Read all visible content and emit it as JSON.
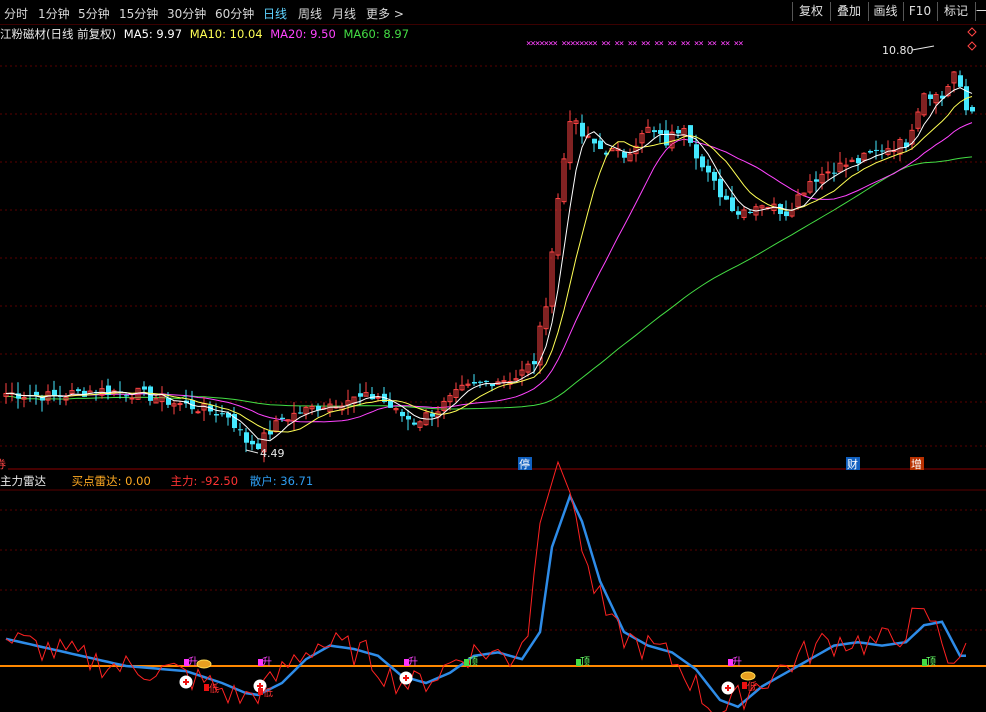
{
  "toolbar": {
    "timeframes": [
      "分时",
      "1分钟",
      "5分钟",
      "15分钟",
      "30分钟",
      "60分钟",
      "日线",
      "周线",
      "月线",
      "更多 >"
    ],
    "active_timeframe": "日线",
    "buttons": [
      "复权",
      "叠加",
      "画线",
      "F10",
      "标记",
      "一"
    ]
  },
  "legend": {
    "title": "江粉磁材(日线 前复权)",
    "ma5": "MA5: 9.97",
    "ma10": "MA10: 10.04",
    "ma20": "MA20: 9.50",
    "ma60": "MA60: 8.97"
  },
  "annotations": {
    "high_label": "10.80",
    "low_label": "4.49",
    "left_marker": "券",
    "stop_marker": "停",
    "fin_marker": "财",
    "inc_marker": "增"
  },
  "indicator": {
    "title": "主力雷达",
    "buy": "买点雷达: 0.00",
    "main": "主力: -92.50",
    "retail": "散户: 36.71",
    "rise_label": "升",
    "top_label": "顶",
    "low_label": "低"
  },
  "colors": {
    "ma5": "#ffffff",
    "ma10": "#ffff55",
    "ma20": "#ff44ff",
    "ma60": "#44dd44",
    "up": "#ff4444",
    "down": "#44e8ff",
    "main_line": "#ff2222",
    "retail_line": "#2e8ce8",
    "zero_line": "#ff8800"
  }
}
